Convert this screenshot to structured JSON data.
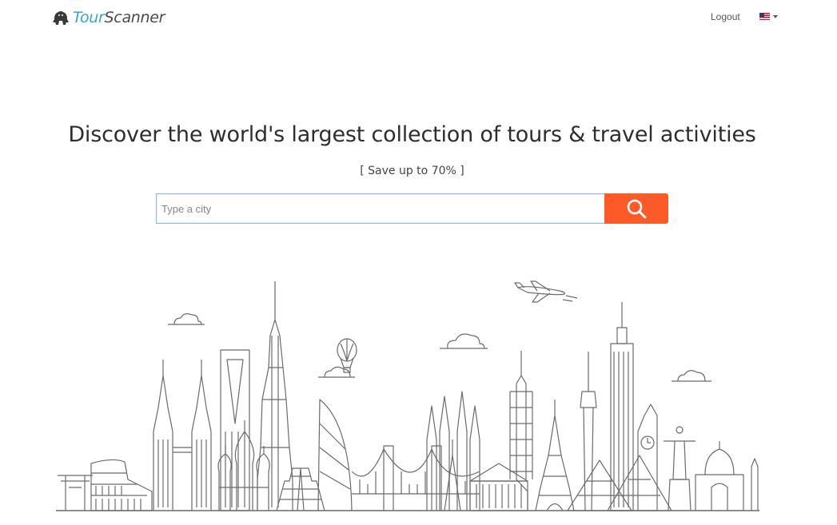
{
  "header": {
    "logo": {
      "part1": "Tour",
      "part2": "Scanner",
      "icon": "gorilla-logo-icon"
    },
    "logout_label": "Logout",
    "language": {
      "icon": "us-flag-icon",
      "caret_icon": "caret-down-icon"
    }
  },
  "hero": {
    "title": "Discover the world's largest collection of tours & travel activities",
    "subtitle": "[ Save up to 70% ]"
  },
  "search": {
    "placeholder": "Type a city",
    "value": "",
    "button_icon": "search-icon"
  },
  "illustration": {
    "name": "world-landmarks-skyline"
  },
  "colors": {
    "accent": "#fd5a2a",
    "logo_blue": "#3aa0d8",
    "line_art": "#6b6b6b",
    "input_border": "#8fb6e8"
  }
}
